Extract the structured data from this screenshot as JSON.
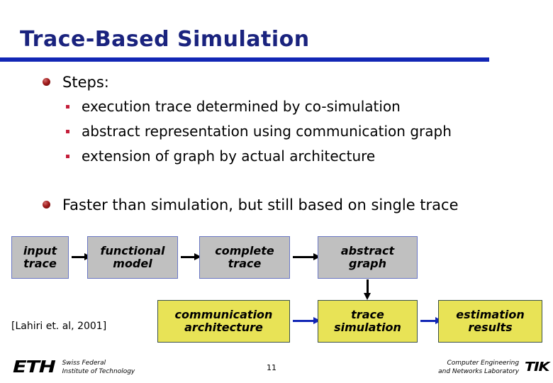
{
  "slide": {
    "title": "Trace-Based Simulation",
    "page_number": "11",
    "citation": "[Lahiri et. al, 2001]",
    "accent_color": "#1226b5",
    "title_color": "#1a237e"
  },
  "bullets": {
    "main": [
      {
        "text": "Steps:"
      },
      {
        "text": "Faster than simulation, but still based on single trace"
      }
    ],
    "sub": [
      {
        "text": "execution trace determined by co-simulation"
      },
      {
        "text": "abstract representation using communication graph"
      },
      {
        "text": "extension of graph by actual architecture"
      }
    ]
  },
  "diagram": {
    "gray_color": "#c0c0c0",
    "yellow_color": "#e8e356",
    "row1": [
      {
        "line1": "input",
        "line2": "trace"
      },
      {
        "line1": "functional",
        "line2": "model"
      },
      {
        "line1": "complete",
        "line2": "trace"
      },
      {
        "line1": "abstract",
        "line2": "graph"
      }
    ],
    "row2": [
      {
        "line1": "communication",
        "line2": "architecture"
      },
      {
        "line1": "trace",
        "line2": "simulation"
      },
      {
        "line1": "estimation",
        "line2": "results"
      }
    ]
  },
  "footer": {
    "eth_logo": "ETH",
    "eth_line1": "Swiss Federal",
    "eth_line2": "Institute of Technology",
    "tik_line1": "Computer Engineering",
    "tik_line2": "and Networks Laboratory",
    "tik_logo": "TIK"
  }
}
